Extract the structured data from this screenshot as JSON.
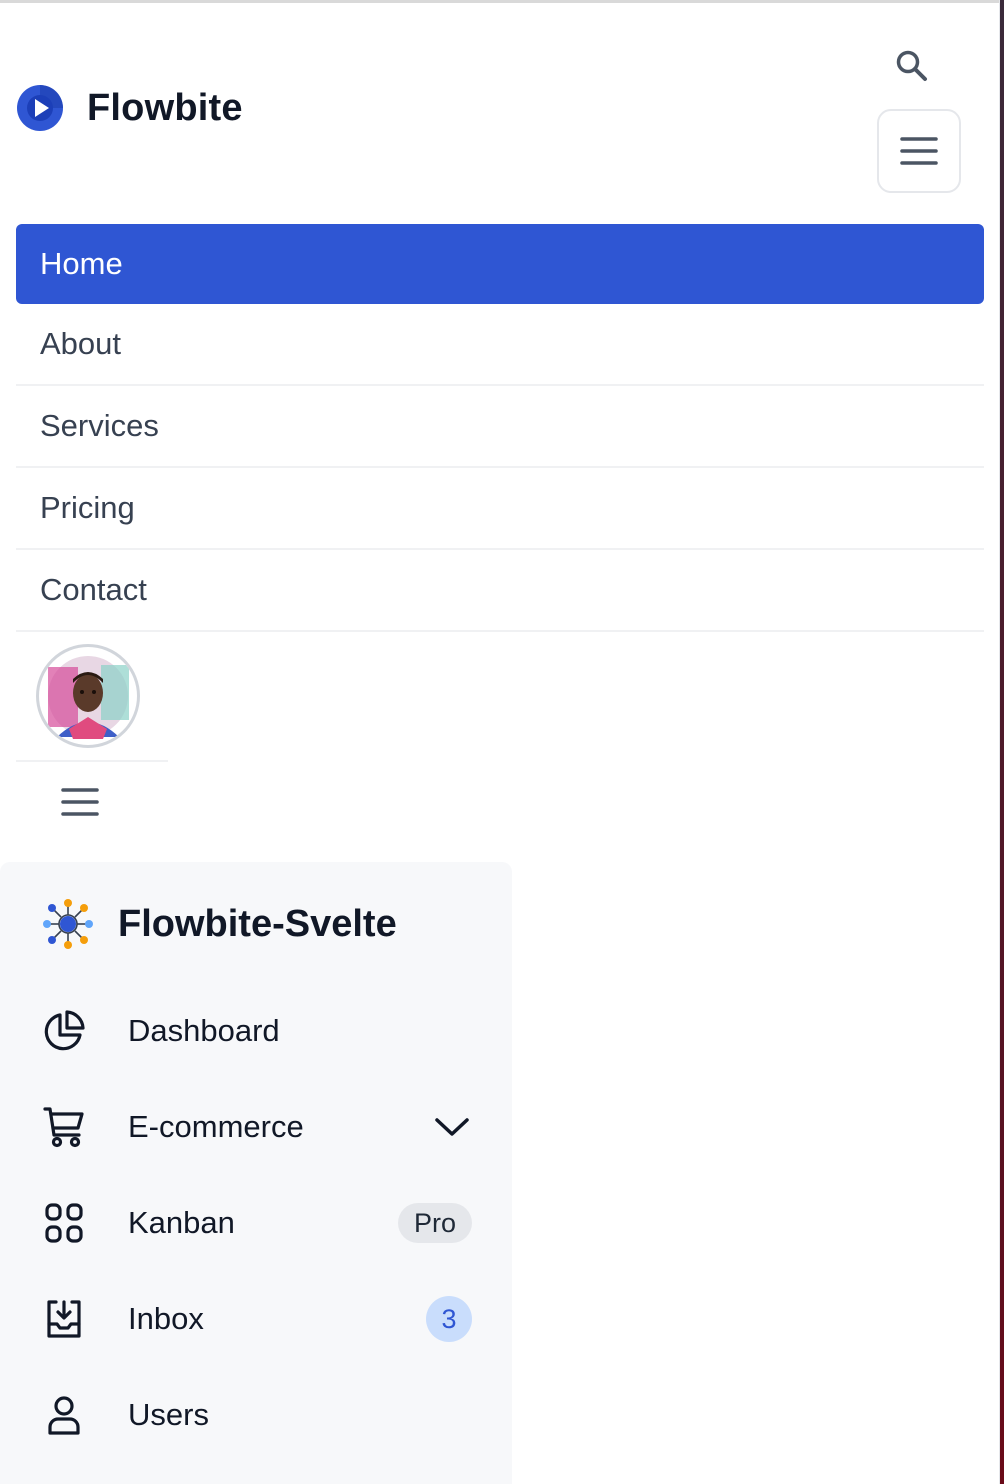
{
  "navbar": {
    "brand": {
      "name": "Flowbite",
      "logo_icon": "flowbite-logo-icon"
    },
    "search_icon": "search-icon",
    "menu_icon": "hamburger-menu-icon",
    "links": [
      {
        "label": "Home",
        "active": true
      },
      {
        "label": "About",
        "active": false
      },
      {
        "label": "Services",
        "active": false
      },
      {
        "label": "Pricing",
        "active": false
      },
      {
        "label": "Contact",
        "active": false
      }
    ],
    "avatar_icon": "user-avatar",
    "secondary_menu_icon": "hamburger-menu-icon"
  },
  "sidebar": {
    "brand": {
      "name": "Flowbite-Svelte",
      "logo_icon": "flowbite-svelte-logo-icon"
    },
    "items": [
      {
        "label": "Dashboard",
        "icon": "chart-pie-icon"
      },
      {
        "label": "E-commerce",
        "icon": "cart-icon",
        "expand_icon": "chevron-down-icon"
      },
      {
        "label": "Kanban",
        "icon": "grid-icon",
        "badge": "Pro"
      },
      {
        "label": "Inbox",
        "icon": "inbox-icon",
        "badge": "3"
      },
      {
        "label": "Users",
        "icon": "user-icon"
      }
    ]
  },
  "colors": {
    "primary": "#2f56d3",
    "sidebar_bg": "#f7f8fa",
    "badge_blue_bg": "#c9ddfc"
  }
}
